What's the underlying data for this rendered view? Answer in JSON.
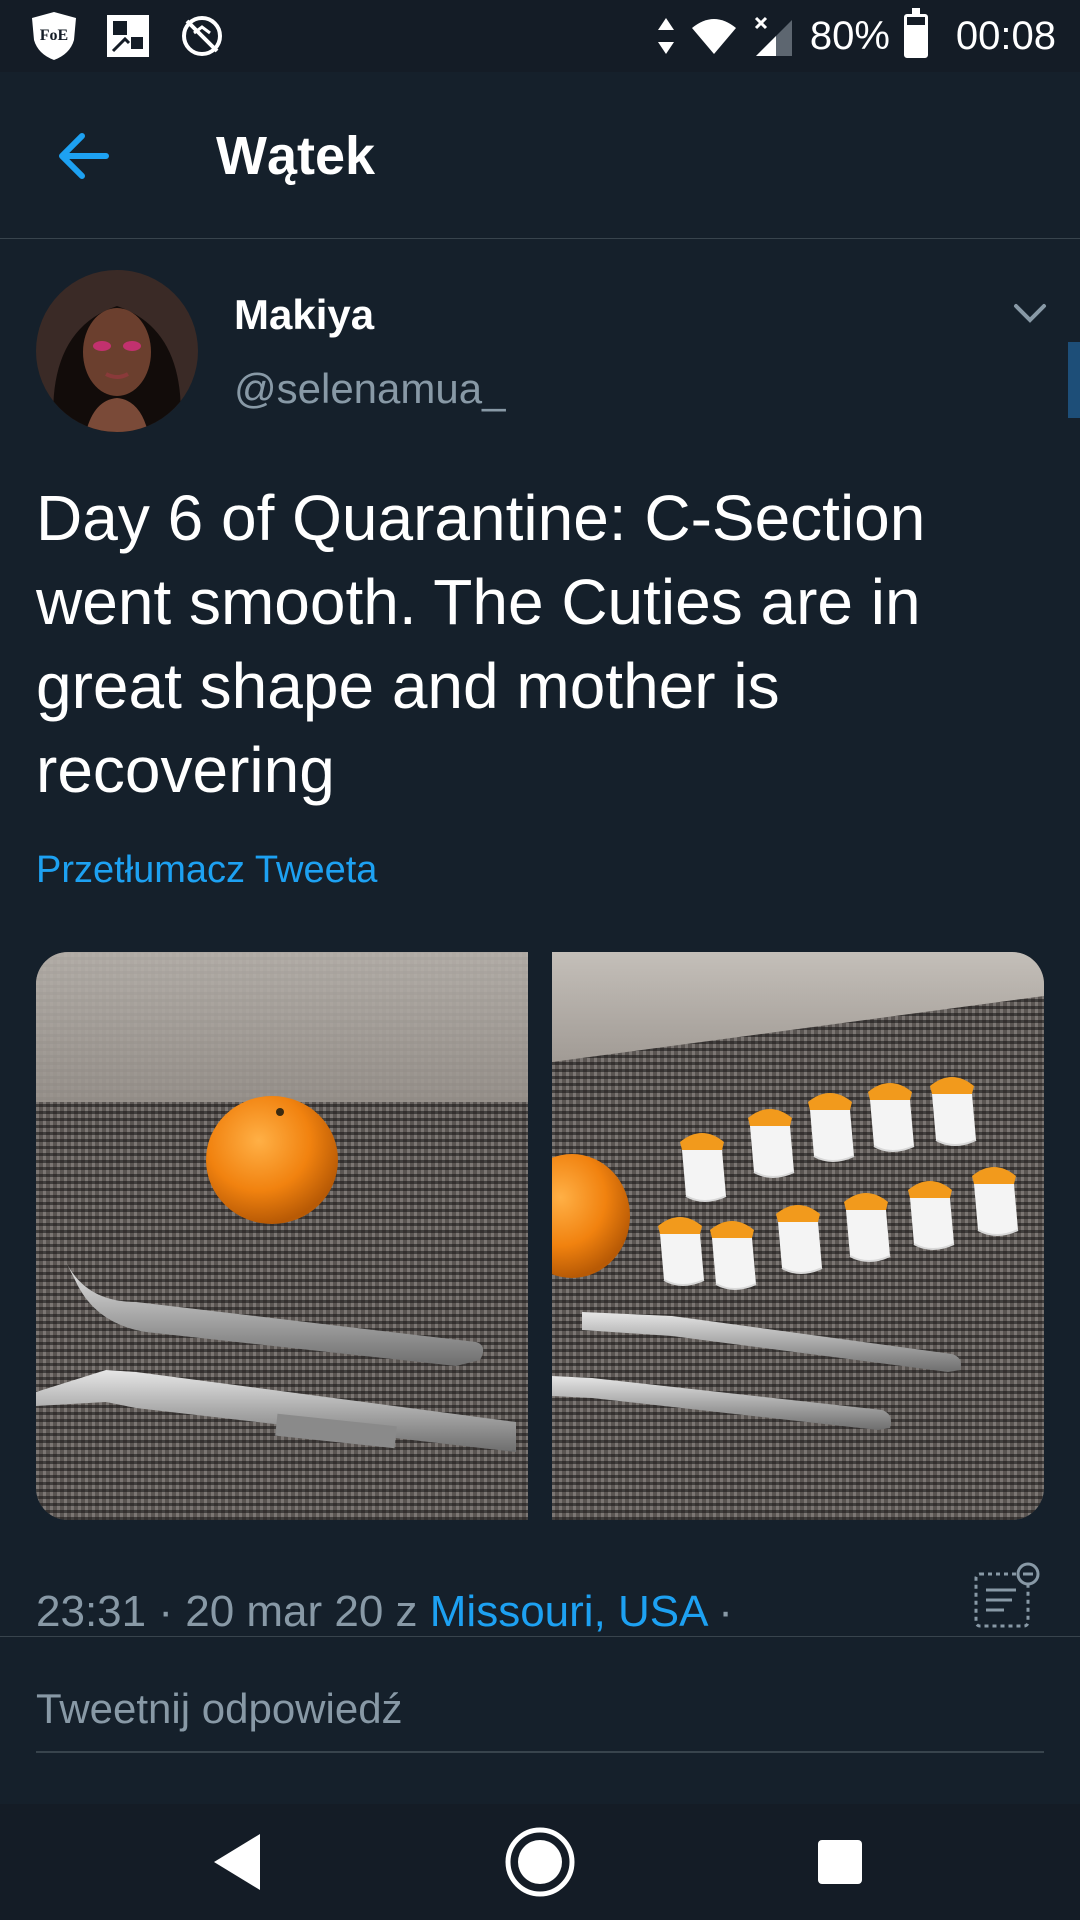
{
  "status_bar": {
    "left_icons": [
      "shield-foe-icon",
      "photo-grid-icon",
      "no-sync-icon"
    ],
    "foe_badge": "FoE",
    "battery_percent_label": "80%",
    "battery_level": 0.8,
    "time": "00:08"
  },
  "header": {
    "title": "Wątek",
    "back_icon": "arrow-left-icon"
  },
  "author": {
    "name": "Makiya",
    "handle": "@selenamua_"
  },
  "tweet": {
    "text": "Day 6 of Quarantine: C-Section went smooth. The Cuties are in great shape and mother is recovering",
    "translate_label": "Przetłumacz Tweeta",
    "time": "23:31",
    "sep1": " · ",
    "date": "20 mar 20",
    "from_label": " z ",
    "place": "Missouri, USA",
    "sep2": " ·"
  },
  "reply": {
    "placeholder": "Tweetnij odpowiedź"
  },
  "colors": {
    "background": "#15202b",
    "accent": "#1da1f2",
    "secondary_text": "#8899a6",
    "divider": "#38444d"
  }
}
